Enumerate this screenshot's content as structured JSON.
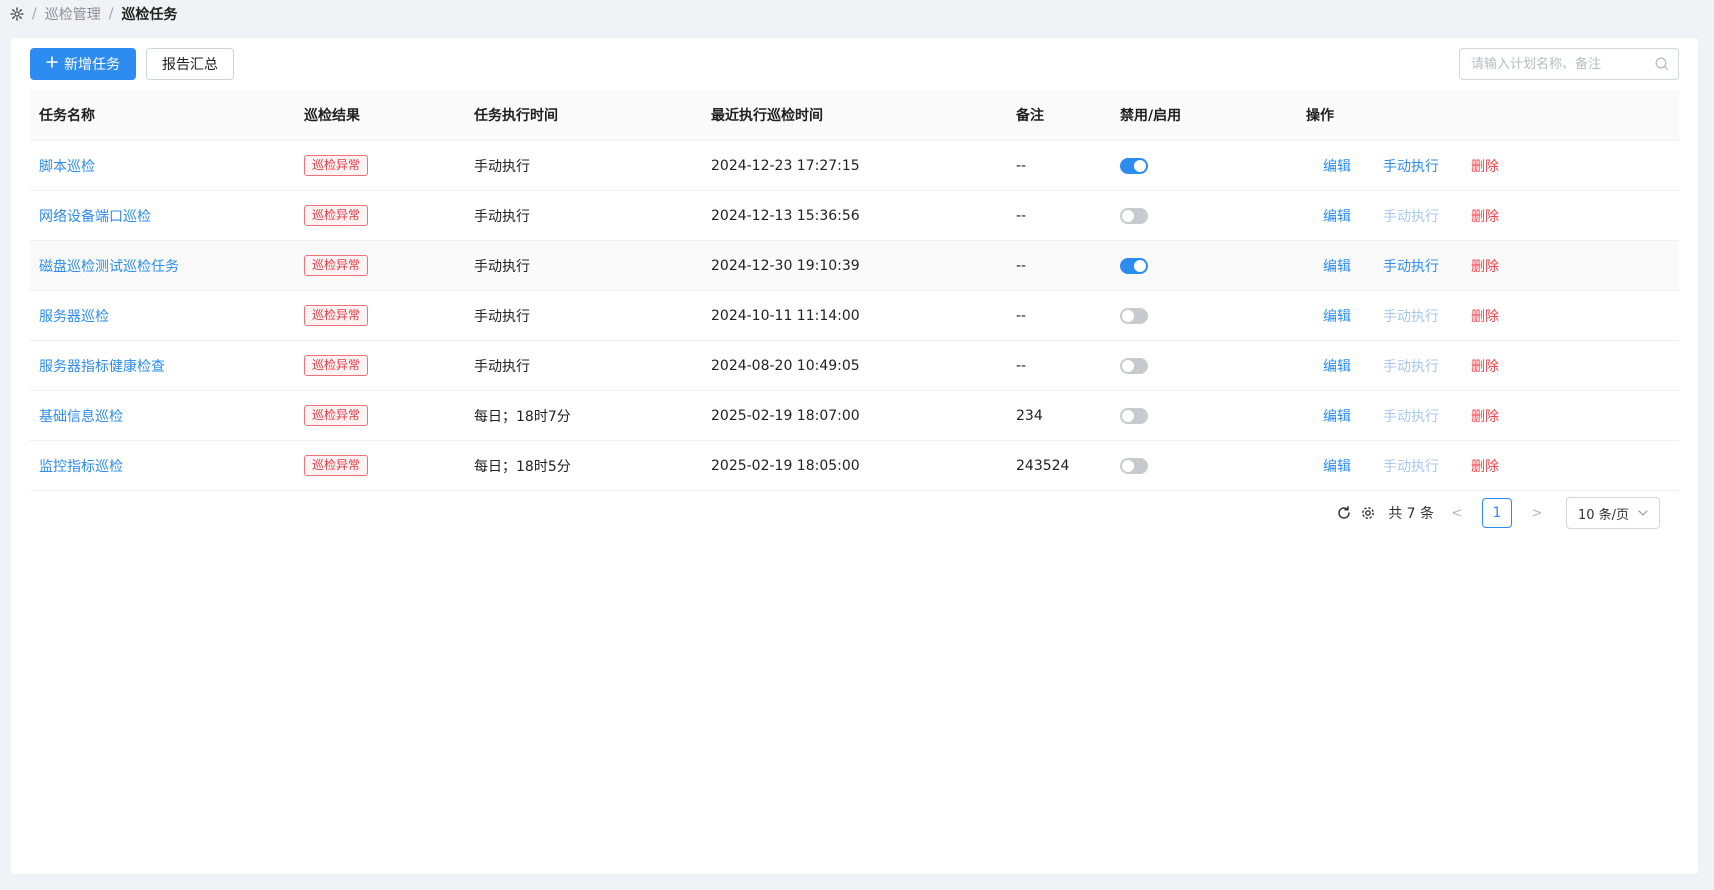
{
  "breadcrumb": {
    "items": [
      "巡检管理"
    ],
    "current": "巡检任务"
  },
  "toolbar": {
    "add_label": "新增任务",
    "report_label": "报告汇总"
  },
  "search": {
    "placeholder": "请输入计划名称、备注",
    "value": ""
  },
  "table": {
    "headers": [
      "任务名称",
      "巡检结果",
      "任务执行时间",
      "最近执行巡检时间",
      "备注",
      "禁用/启用",
      "操作"
    ],
    "rows": [
      {
        "name": "脚本巡检",
        "result": "巡检异常",
        "schedule": "手动执行",
        "last_run": "2024-12-23 17:27:15",
        "remark": "--",
        "enabled": true
      },
      {
        "name": "网络设备端口巡检",
        "result": "巡检异常",
        "schedule": "手动执行",
        "last_run": "2024-12-13 15:36:56",
        "remark": "--",
        "enabled": false
      },
      {
        "name": "磁盘巡检测试巡检任务",
        "result": "巡检异常",
        "schedule": "手动执行",
        "last_run": "2024-12-30 19:10:39",
        "remark": "--",
        "enabled": true
      },
      {
        "name": "服务器巡检",
        "result": "巡检异常",
        "schedule": "手动执行",
        "last_run": "2024-10-11 11:14:00",
        "remark": "--",
        "enabled": false
      },
      {
        "name": "服务器指标健康检查",
        "result": "巡检异常",
        "schedule": "手动执行",
        "last_run": "2024-08-20 10:49:05",
        "remark": "--",
        "enabled": false
      },
      {
        "name": "基础信息巡检",
        "result": "巡检异常",
        "schedule": "每日；18时7分",
        "last_run": "2025-02-19 18:07:00",
        "remark": "234",
        "enabled": false
      },
      {
        "name": "监控指标巡检",
        "result": "巡检异常",
        "schedule": "每日；18时5分",
        "last_run": "2025-02-19 18:05:00",
        "remark": "243524",
        "enabled": false
      }
    ],
    "actions": {
      "edit": "编辑",
      "run": "手动执行",
      "delete": "删除"
    }
  },
  "pagination": {
    "total_text": "共 7 条",
    "current_page": "1",
    "page_size": "10 条/页"
  },
  "colors": {
    "primary": "#2d8cf0",
    "danger": "#f0454c",
    "disabled_link": "#a8c8ee"
  }
}
